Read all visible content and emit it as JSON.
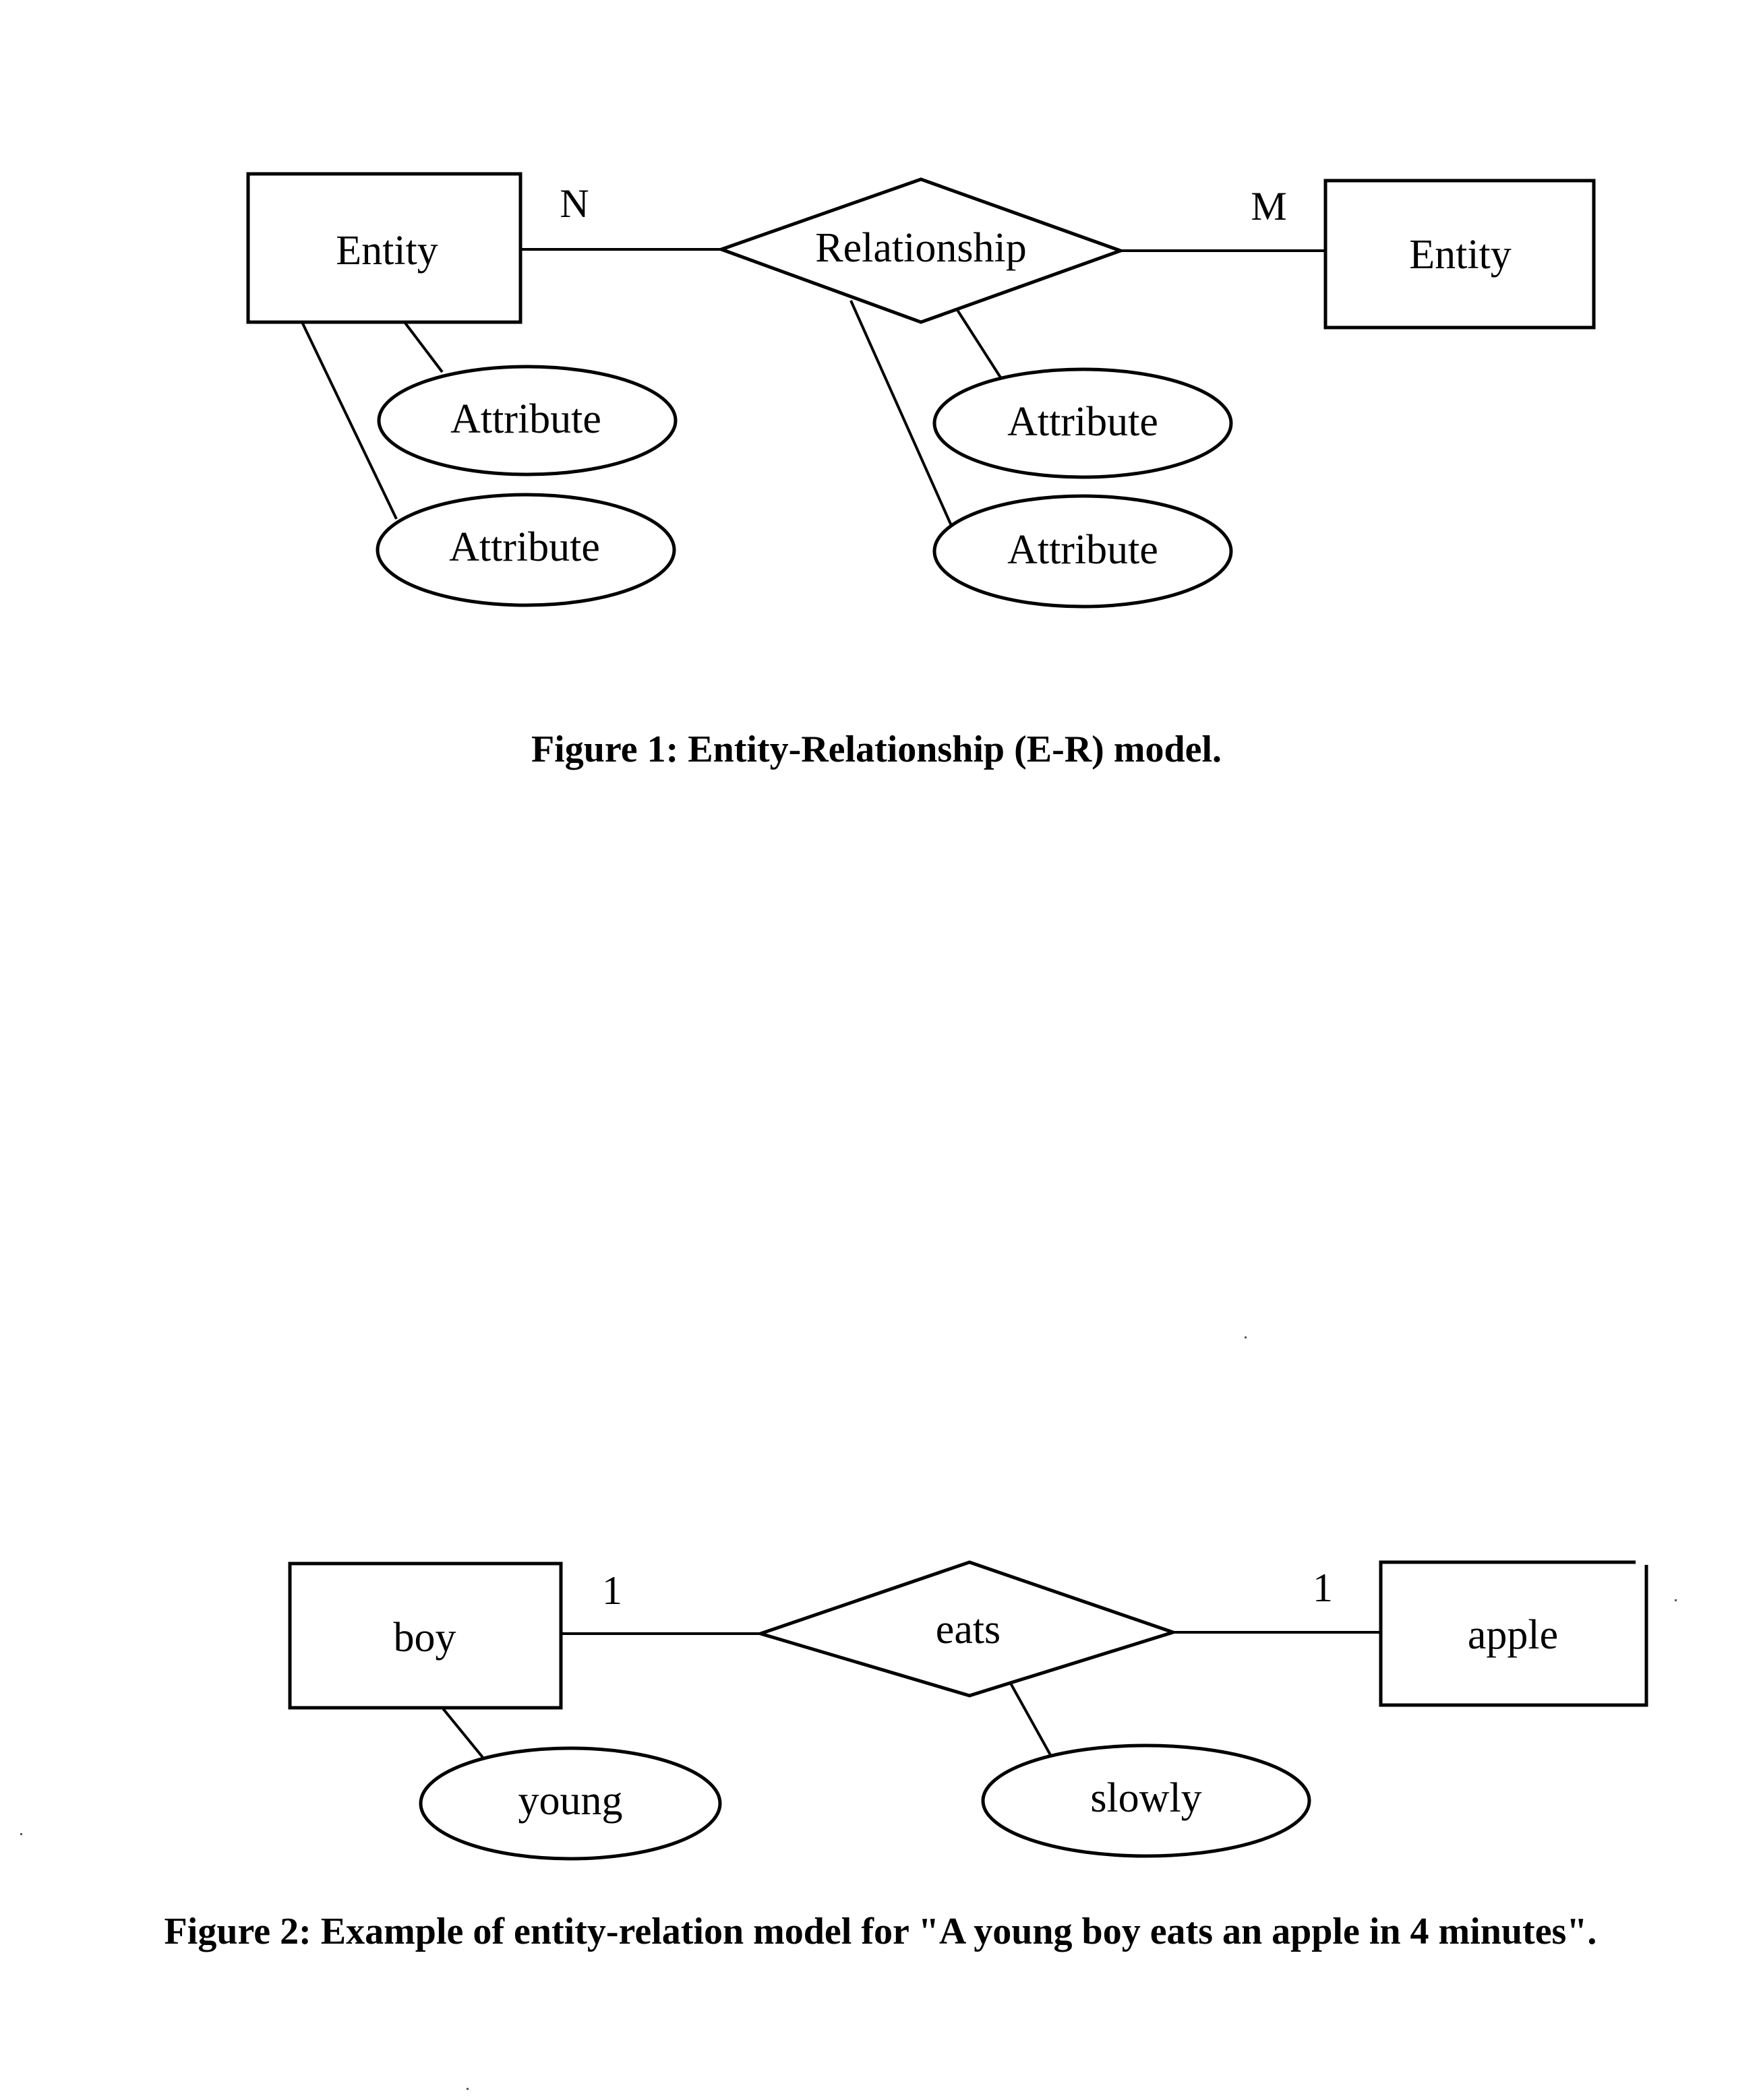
{
  "figure1": {
    "caption": "Figure 1: Entity-Relationship (E-R) model.",
    "left_entity": {
      "label": "Entity",
      "cardinality": "N"
    },
    "relationship": {
      "label": "Relationship"
    },
    "right_entity": {
      "label": "Entity",
      "cardinality": "M"
    },
    "entity_attributes": [
      {
        "label": "Attribute"
      },
      {
        "label": "Attribute"
      }
    ],
    "relationship_attributes": [
      {
        "label": "Attribute"
      },
      {
        "label": "Attribute"
      }
    ]
  },
  "figure2": {
    "caption": "Figure 2: Example of entity-relation model for \"A young boy eats an apple in 4 minutes\".",
    "left_entity": {
      "label": "boy",
      "cardinality": "1"
    },
    "relationship": {
      "label": "eats"
    },
    "right_entity": {
      "label": "apple",
      "cardinality": "1"
    },
    "entity_attributes": [
      {
        "label": "young"
      }
    ],
    "relationship_attributes": [
      {
        "label": "slowly"
      }
    ]
  }
}
